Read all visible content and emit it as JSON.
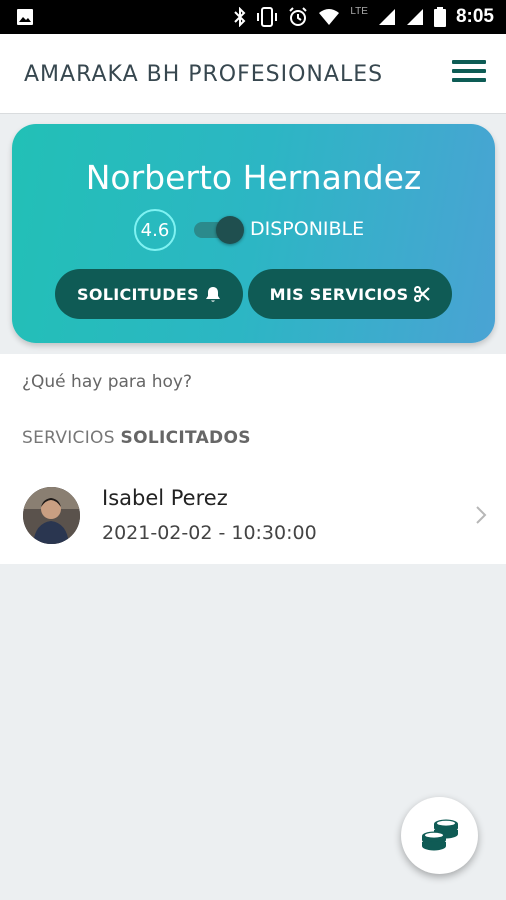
{
  "status_bar": {
    "time": "8:05",
    "network": "LTE"
  },
  "app_bar": {
    "title": "AMARAKA BH PROFESIONALES",
    "menu_icon": "hamburger-menu-icon"
  },
  "profile": {
    "name": "Norberto Hernandez",
    "rating": "4.6",
    "availability_label": "DISPONIBLE",
    "available": true,
    "buttons": {
      "requests_label": "SOLICITUDES",
      "requests_icon": "bell-icon",
      "services_label": "MIS SERVICIOS",
      "services_icon": "scissors-icon"
    }
  },
  "main": {
    "subtitle": "¿Qué hay para hoy?",
    "section_title_a": "SERVICIOS",
    "section_title_b": "SOLICITADOS",
    "items": [
      {
        "name": "Isabel Perez",
        "datetime": "2021-02-02 - 10:30:00"
      }
    ]
  },
  "fab": {
    "icon": "coins-icon"
  },
  "colors": {
    "accent": "#0f5b55",
    "card_gradient_start": "#22c0b6",
    "card_gradient_end": "#4aa3d4"
  }
}
